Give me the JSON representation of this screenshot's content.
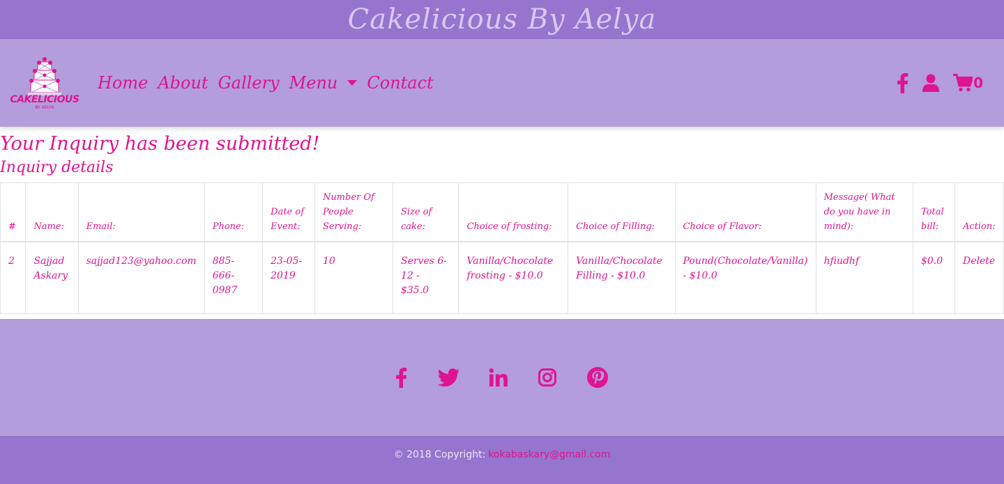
{
  "site": {
    "title": "Cakelicious By Aelya"
  },
  "logo": {
    "text": "CAKELICIOUS",
    "sub": "BY AELYA"
  },
  "nav": {
    "links": [
      {
        "label": "Home"
      },
      {
        "label": "About"
      },
      {
        "label": "Gallery"
      },
      {
        "label": "Menu"
      },
      {
        "label": "Contact"
      }
    ],
    "icons": [
      "facebook-icon",
      "user-icon",
      "cart-icon"
    ],
    "cart_count": "0"
  },
  "page": {
    "message": "Your Inquiry has been submitted!",
    "subtitle": "Inquiry details"
  },
  "table": {
    "headers": [
      "#",
      "Name:",
      "Email:",
      "Phone:",
      "Date of Event:",
      "Number Of People Serving:",
      "Size of cake:",
      "Choice of frosting:",
      "Choice of Filling:",
      "Choice of Flavor:",
      "Message( What do you have in mind):",
      "Total bill:",
      "Action:"
    ],
    "rows": [
      [
        "2",
        "Sajjad Askary",
        "sajjad123@yahoo.com",
        "885-666-0987",
        "23-05-2019",
        "10",
        "Serves 6-12 - $35.0",
        "Vanilla/Chocolate frosting - $10.0",
        "Vanilla/Chocolate Filling - $10.0",
        "Pound(Chocolate/Vanilla) - $10.0",
        "hfiudhf",
        "$0.0",
        "Delete"
      ]
    ]
  },
  "footer": {
    "social": [
      "facebook-icon",
      "twitter-icon",
      "linkedin-icon",
      "instagram-icon",
      "pinterest-icon"
    ],
    "copyright": "© 2018 Copyright:",
    "email": "kokabaskary@gmail.com"
  },
  "colors": {
    "accent": "#e0148f",
    "header": "#9575cd",
    "nav": "#b39ddb"
  }
}
